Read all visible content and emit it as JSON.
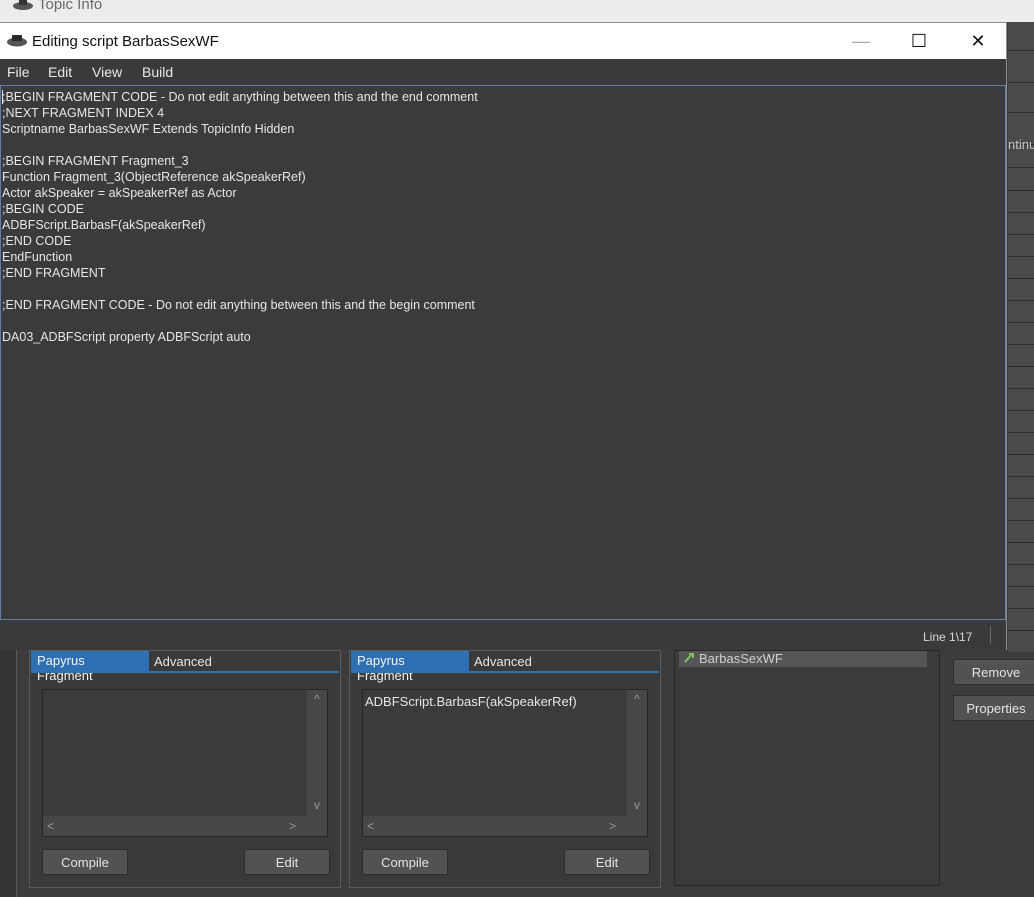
{
  "background_window": {
    "title": "Topic Info",
    "side_label": "ntinu"
  },
  "editor_window": {
    "title": "Editing script BarbasSexWF",
    "controls": {
      "minimize": "—",
      "maximize": "☐",
      "close": "✕"
    },
    "menu": [
      "File",
      "Edit",
      "View",
      "Build"
    ],
    "code_lines": [
      ";BEGIN FRAGMENT CODE - Do not edit anything between this and the end comment",
      ";NEXT FRAGMENT INDEX 4",
      "Scriptname BarbasSexWF Extends TopicInfo Hidden",
      "",
      ";BEGIN FRAGMENT Fragment_3",
      "Function Fragment_3(ObjectReference akSpeakerRef)",
      "Actor akSpeaker = akSpeakerRef as Actor",
      ";BEGIN CODE",
      "ADBFScript.BarbasF(akSpeakerRef)",
      ";END CODE",
      "EndFunction",
      ";END FRAGMENT",
      "",
      ";END FRAGMENT CODE - Do not edit anything between this and the begin comment",
      "",
      "DA03_ADBFScript property ADBFScript auto"
    ],
    "status": "Line 1\\17"
  },
  "fragment_panels": [
    {
      "tab_active": "Papyrus Fragment",
      "tab": "Advanced",
      "text": "",
      "compile_label": "Compile",
      "edit_label": "Edit"
    },
    {
      "tab_active": "Papyrus Fragment",
      "tab": "Advanced",
      "text": "ADBFScript.BarbasF(akSpeakerRef)",
      "compile_label": "Compile",
      "edit_label": "Edit"
    }
  ],
  "scripts_list": {
    "items": [
      "BarbasSexWF"
    ]
  },
  "script_buttons": {
    "remove_label": "Remove",
    "properties_label": "Properties"
  },
  "icons": {
    "scroll_up": "^",
    "scroll_down": "v",
    "scroll_left": "<",
    "scroll_right": ">"
  }
}
